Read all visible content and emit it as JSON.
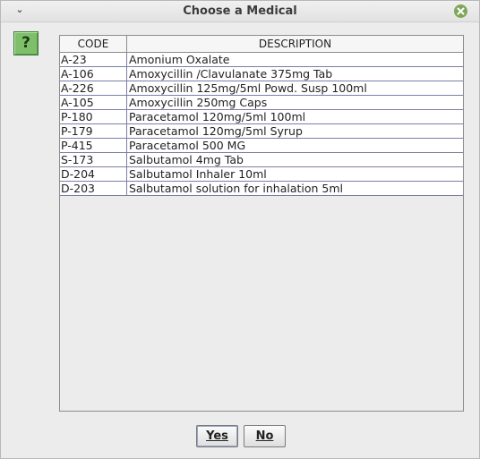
{
  "window": {
    "title": "Choose a Medical",
    "menu_glyph": "⌄",
    "menu_icon": "chevron-down-icon",
    "close_icon": "close-icon",
    "help_icon": "question-icon",
    "help_glyph": "?"
  },
  "table": {
    "columns": [
      "CODE",
      "DESCRIPTION"
    ],
    "rows": [
      {
        "code": "A-23",
        "description": "Amonium Oxalate"
      },
      {
        "code": "A-106",
        "description": "Amoxycillin /Clavulanate 375mg Tab"
      },
      {
        "code": "A-226",
        "description": "Amoxycillin 125mg/5ml Powd. Susp 100ml"
      },
      {
        "code": "A-105",
        "description": "Amoxycillin 250mg Caps"
      },
      {
        "code": "P-180",
        "description": "Paracetamol 120mg/5ml 100ml"
      },
      {
        "code": "P-179",
        "description": "Paracetamol 120mg/5ml Syrup"
      },
      {
        "code": "P-415",
        "description": "Paracetamol 500 MG"
      },
      {
        "code": "S-173",
        "description": "Salbutamol 4mg Tab"
      },
      {
        "code": "D-204",
        "description": "Salbutamol Inhaler 10ml"
      },
      {
        "code": "D-203",
        "description": "Salbutamol solution for inhalation 5ml"
      }
    ]
  },
  "buttons": {
    "yes_label": "Yes",
    "no_label": "No"
  },
  "colors": {
    "close_button": "#7ea75a",
    "help_icon_bg": "#7fbf6b",
    "row_border": "#7b7fa6"
  }
}
